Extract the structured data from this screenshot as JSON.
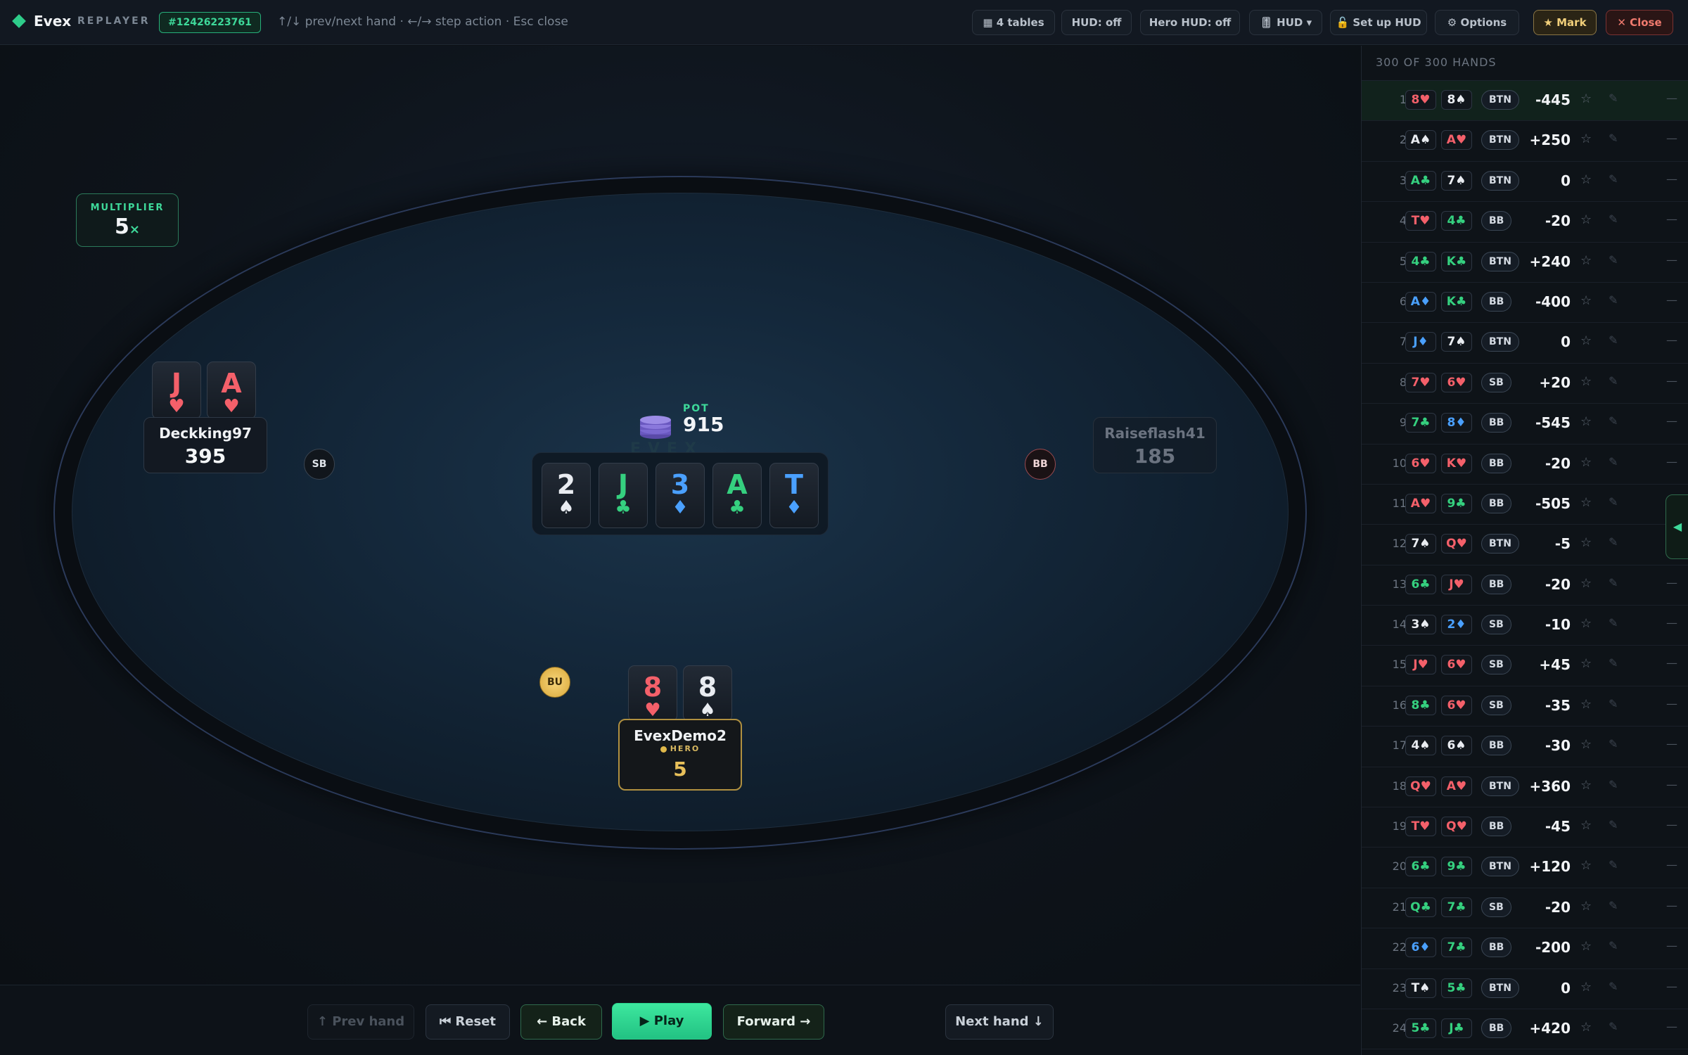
{
  "topbar": {
    "logo": "Evex",
    "logo_sub": "REPLAYER",
    "hand_id": "#12426223761",
    "hint": "↑/↓ prev/next hand · ←/→ step action · Esc close",
    "buttons": {
      "tables": "▦ 4 tables",
      "hud_off": "HUD: off",
      "hero_hud_off": "Hero HUD: off",
      "hud_menu": "🎚 HUD ▾",
      "setup_hud": "🔓 Set up HUD",
      "options": "⚙ Options",
      "mark": "★ Mark",
      "close": "✕ Close"
    }
  },
  "table": {
    "multiplier_label": "MULTIPLIER",
    "multiplier_value": "5",
    "multiplier_suffix": "×",
    "pot_label": "POT",
    "pot_value": "915",
    "watermark": "EVEX",
    "board": [
      {
        "rank": "2",
        "suit": "♠",
        "color": "#e9ecf1"
      },
      {
        "rank": "J",
        "suit": "♣",
        "color": "#35d07f"
      },
      {
        "rank": "3",
        "suit": "♦",
        "color": "#4aa0ff"
      },
      {
        "rank": "A",
        "suit": "♣",
        "color": "#35d07f"
      },
      {
        "rank": "T",
        "suit": "♦",
        "color": "#4aa0ff"
      }
    ],
    "players": {
      "left": {
        "name": "Deckking97",
        "stack": "395",
        "cards": [
          {
            "rank": "J",
            "suit": "♥"
          },
          {
            "rank": "A",
            "suit": "♥"
          }
        ]
      },
      "right": {
        "name": "Raiseflash41",
        "stack": "185"
      },
      "hero": {
        "name": "EvexDemo2",
        "badge": "HERO",
        "stack": "5",
        "cards": [
          {
            "rank": "8",
            "suit": "♥"
          },
          {
            "rank": "8",
            "suit": "♠"
          }
        ]
      }
    },
    "chips": {
      "sb": "SB",
      "bb": "BB",
      "bu": "BU"
    }
  },
  "controls": {
    "prev_hand": "↑ Prev hand",
    "reset": "⏮ Reset",
    "back": "← Back",
    "play": "▶ Play",
    "forward": "Forward →",
    "next_hand": "Next hand ↓"
  },
  "sidebar": {
    "header": "300 OF 300 HANDS",
    "star": "☆",
    "pen": "✎",
    "dash": "—",
    "tab_icon": "◀",
    "hands": [
      {
        "n": "1",
        "c1": "8♥",
        "k1": "red",
        "c2": "8♠",
        "k2": "white",
        "pos": "BTN",
        "amt": "-445"
      },
      {
        "n": "2",
        "c1": "A♠",
        "k1": "white",
        "c2": "A♥",
        "k2": "red",
        "pos": "BTN",
        "amt": "+250"
      },
      {
        "n": "3",
        "c1": "A♣",
        "k1": "green",
        "c2": "7♠",
        "k2": "white",
        "pos": "BTN",
        "amt": "0"
      },
      {
        "n": "4",
        "c1": "T♥",
        "k1": "red",
        "c2": "4♣",
        "k2": "green",
        "pos": "BB",
        "amt": "-20"
      },
      {
        "n": "5",
        "c1": "4♣",
        "k1": "green",
        "c2": "K♣",
        "k2": "green",
        "pos": "BTN",
        "amt": "+240"
      },
      {
        "n": "6",
        "c1": "A♦",
        "k1": "blue",
        "c2": "K♣",
        "k2": "green",
        "pos": "BB",
        "amt": "-400"
      },
      {
        "n": "7",
        "c1": "J♦",
        "k1": "blue",
        "c2": "7♠",
        "k2": "white",
        "pos": "BTN",
        "amt": "0"
      },
      {
        "n": "8",
        "c1": "7♥",
        "k1": "red",
        "c2": "6♥",
        "k2": "red",
        "pos": "SB",
        "amt": "+20"
      },
      {
        "n": "9",
        "c1": "7♣",
        "k1": "green",
        "c2": "8♦",
        "k2": "blue",
        "pos": "BB",
        "amt": "-545"
      },
      {
        "n": "10",
        "c1": "6♥",
        "k1": "red",
        "c2": "K♥",
        "k2": "red",
        "pos": "BB",
        "amt": "-20"
      },
      {
        "n": "11",
        "c1": "A♥",
        "k1": "red",
        "c2": "9♣",
        "k2": "green",
        "pos": "BB",
        "amt": "-505"
      },
      {
        "n": "12",
        "c1": "7♠",
        "k1": "white",
        "c2": "Q♥",
        "k2": "red",
        "pos": "BTN",
        "amt": "-5"
      },
      {
        "n": "13",
        "c1": "6♣",
        "k1": "green",
        "c2": "J♥",
        "k2": "red",
        "pos": "BB",
        "amt": "-20"
      },
      {
        "n": "14",
        "c1": "3♠",
        "k1": "white",
        "c2": "2♦",
        "k2": "blue",
        "pos": "SB",
        "amt": "-10"
      },
      {
        "n": "15",
        "c1": "J♥",
        "k1": "red",
        "c2": "6♥",
        "k2": "red",
        "pos": "SB",
        "amt": "+45"
      },
      {
        "n": "16",
        "c1": "8♣",
        "k1": "green",
        "c2": "6♥",
        "k2": "red",
        "pos": "SB",
        "amt": "-35"
      },
      {
        "n": "17",
        "c1": "4♠",
        "k1": "white",
        "c2": "6♠",
        "k2": "white",
        "pos": "BB",
        "amt": "-30"
      },
      {
        "n": "18",
        "c1": "Q♥",
        "k1": "red",
        "c2": "A♥",
        "k2": "red",
        "pos": "BTN",
        "amt": "+360"
      },
      {
        "n": "19",
        "c1": "T♥",
        "k1": "red",
        "c2": "Q♥",
        "k2": "red",
        "pos": "BB",
        "amt": "-45"
      },
      {
        "n": "20",
        "c1": "6♣",
        "k1": "green",
        "c2": "9♣",
        "k2": "green",
        "pos": "BTN",
        "amt": "+120"
      },
      {
        "n": "21",
        "c1": "Q♣",
        "k1": "green",
        "c2": "7♣",
        "k2": "green",
        "pos": "SB",
        "amt": "-20"
      },
      {
        "n": "22",
        "c1": "6♦",
        "k1": "blue",
        "c2": "7♣",
        "k2": "green",
        "pos": "BB",
        "amt": "-200"
      },
      {
        "n": "23",
        "c1": "T♠",
        "k1": "white",
        "c2": "5♣",
        "k2": "green",
        "pos": "BTN",
        "amt": "0"
      },
      {
        "n": "24",
        "c1": "5♣",
        "k1": "green",
        "c2": "J♣",
        "k2": "green",
        "pos": "BB",
        "amt": "+420"
      }
    ]
  }
}
